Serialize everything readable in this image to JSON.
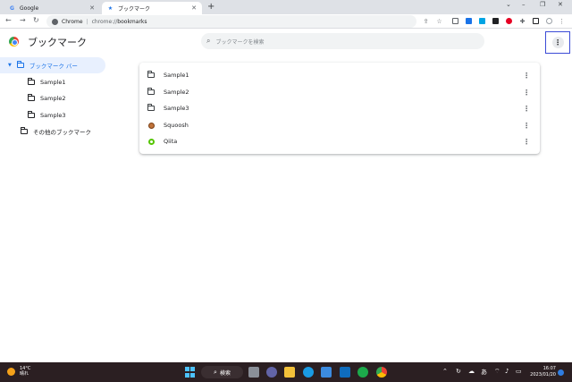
{
  "browser": {
    "tabs": [
      {
        "title": "Google",
        "icon": "google-g-icon",
        "active": false
      },
      {
        "title": "ブックマーク",
        "icon": "star-icon",
        "active": true
      }
    ],
    "window_controls": {
      "minimize": "–",
      "maximize": "❐",
      "close": "✕"
    },
    "omnibox": {
      "site_label": "Chrome",
      "separator": "|",
      "url_scheme": "chrome://",
      "url_path": "bookmarks"
    }
  },
  "bookmarks_page": {
    "title": "ブックマーク",
    "search_placeholder": "ブックマークを検索",
    "menu_icon": "more-vert-icon"
  },
  "sidebar": {
    "root": {
      "label": "ブックマーク バー",
      "expanded": true
    },
    "children": [
      {
        "label": "Sample1"
      },
      {
        "label": "Sample2"
      },
      {
        "label": "Sample3"
      }
    ],
    "other": {
      "label": "その他のブックマーク"
    }
  },
  "bookmarks": [
    {
      "label": "Sample1",
      "type": "folder"
    },
    {
      "label": "Sample2",
      "type": "folder"
    },
    {
      "label": "Sample3",
      "type": "folder"
    },
    {
      "label": "Squoosh",
      "type": "site",
      "icon": "squoosh-icon"
    },
    {
      "label": "Qiita",
      "type": "site",
      "icon": "qiita-icon"
    }
  ],
  "taskbar": {
    "weather": {
      "temp": "14°C",
      "condition": "晴れ"
    },
    "search_label": "検索",
    "ime": "あ",
    "time": "16:07",
    "date": "2023/01/20"
  },
  "colors": {
    "accent": "#1a73e8",
    "selected_bg": "#e8f0fe",
    "taskbar_bg": "#2b1f22"
  }
}
